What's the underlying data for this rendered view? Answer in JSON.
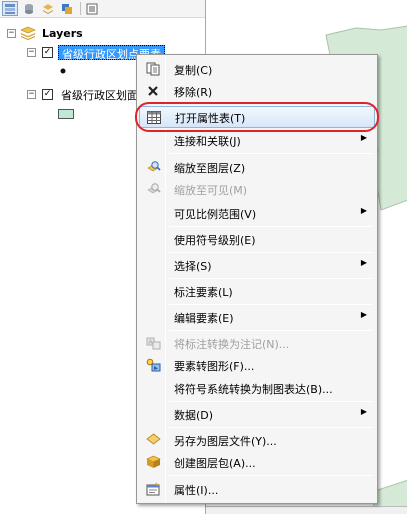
{
  "toc": {
    "root_label": "Layers",
    "layers": [
      {
        "label": "省级行政区划点要素",
        "checked": true,
        "selected": true
      },
      {
        "label": "省级行政区划面",
        "checked": true,
        "selected": false
      }
    ],
    "layer_polygon_symbol_color": "#bfe8d5"
  },
  "map": {
    "polygon_fill_color": "#d4ead6",
    "polygon_stroke_color": "#a9c1ab"
  },
  "context_menu": {
    "items": [
      {
        "label": "复制(C)",
        "icon": "copy-icon",
        "enabled": true,
        "submenu": false
      },
      {
        "label": "移除(R)",
        "icon": "remove-icon",
        "enabled": true,
        "submenu": false
      },
      {
        "label": "打开属性表(T)",
        "icon": "table-icon",
        "enabled": true,
        "submenu": false,
        "highlighted": true
      },
      {
        "label": "连接和关联(J)",
        "icon": "",
        "enabled": true,
        "submenu": true
      },
      {
        "label": "缩放至图层(Z)",
        "icon": "zoom-to-layer-icon",
        "enabled": true,
        "submenu": false
      },
      {
        "label": "缩放至可见(M)",
        "icon": "zoom-visible-icon",
        "enabled": false,
        "submenu": false
      },
      {
        "label": "可见比例范围(V)",
        "icon": "",
        "enabled": true,
        "submenu": true
      },
      {
        "label": "使用符号级别(E)",
        "icon": "",
        "enabled": true,
        "submenu": false
      },
      {
        "label": "选择(S)",
        "icon": "",
        "enabled": true,
        "submenu": true
      },
      {
        "label": "标注要素(L)",
        "icon": "",
        "enabled": true,
        "submenu": false
      },
      {
        "label": "编辑要素(E)",
        "icon": "",
        "enabled": true,
        "submenu": true
      },
      {
        "label": "将标注转换为注记(N)...",
        "icon": "convert-labels-icon",
        "enabled": false,
        "submenu": false
      },
      {
        "label": "要素转图形(F)...",
        "icon": "features-to-graphics-icon",
        "enabled": true,
        "submenu": false
      },
      {
        "label": "将符号系统转换为制图表达(B)...",
        "icon": "",
        "enabled": true,
        "submenu": false
      },
      {
        "label": "数据(D)",
        "icon": "",
        "enabled": true,
        "submenu": true
      },
      {
        "label": "另存为图层文件(Y)...",
        "icon": "layer-file-icon",
        "enabled": true,
        "submenu": false
      },
      {
        "label": "创建图层包(A)...",
        "icon": "layer-package-icon",
        "enabled": true,
        "submenu": false
      },
      {
        "label": "属性(I)...",
        "icon": "properties-icon",
        "enabled": true,
        "submenu": false
      }
    ],
    "highlight_annotation_color": "#e0232b"
  }
}
